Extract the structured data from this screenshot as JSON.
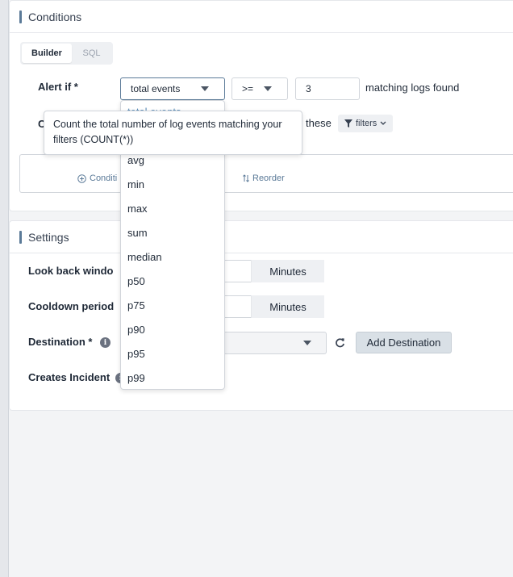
{
  "conditions": {
    "title": "Conditions",
    "tabs": [
      {
        "label": "Builder"
      },
      {
        "label": "SQL"
      }
    ],
    "alert_if_label": "Alert if *",
    "aggregation_selected": "total events",
    "operator_selected": ">=",
    "threshold_value": "3",
    "matching_text": "matching logs found",
    "conditions_row_prefix": "C",
    "conditions_row_text": "these",
    "filters_label": "filters",
    "add_condition_label": "Conditi",
    "reorder_label": "Reorder"
  },
  "dropdown": {
    "options": [
      {
        "label": "total events"
      },
      {
        "label": "avg"
      },
      {
        "label": "min"
      },
      {
        "label": "max"
      },
      {
        "label": "sum"
      },
      {
        "label": "median"
      },
      {
        "label": "p50"
      },
      {
        "label": "p75"
      },
      {
        "label": "p90"
      },
      {
        "label": "p95"
      },
      {
        "label": "p99"
      }
    ]
  },
  "tooltip": {
    "text": "Count the total number of log events matching your filters (COUNT(*))"
  },
  "settings": {
    "title": "Settings",
    "look_back_label": "Look back windo",
    "look_back_unit": "Minutes",
    "cooldown_label": "Cooldown period",
    "cooldown_unit": "Minutes",
    "destination_label": "Destination *",
    "add_destination_label": "Add Destination",
    "creates_incident_label": "Creates Incident"
  },
  "colors": {
    "accent": "#5b7a98",
    "selected_option": "#5b8db8"
  }
}
